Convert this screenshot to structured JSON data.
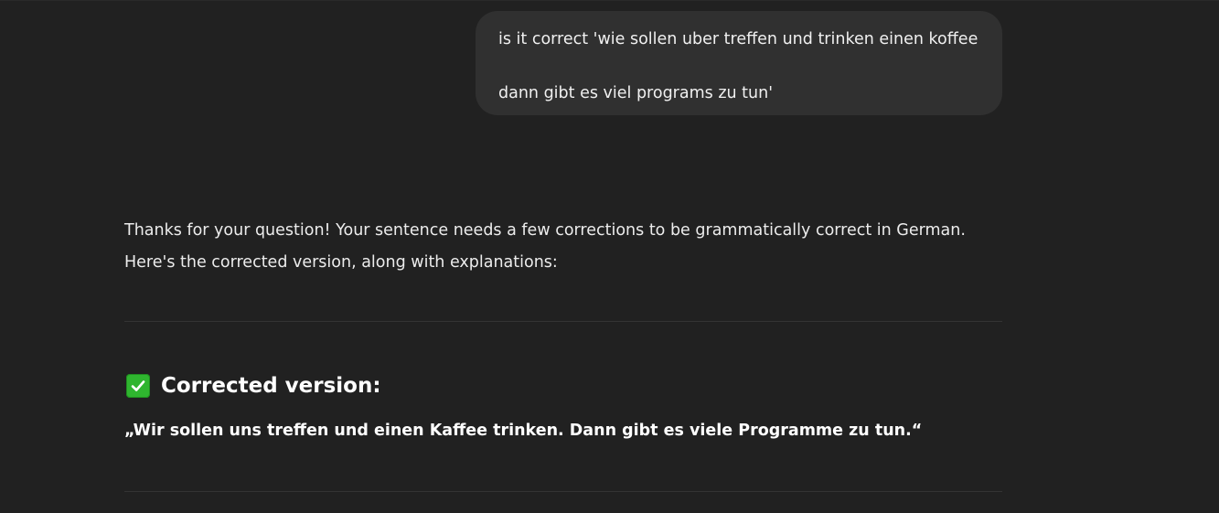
{
  "user_message": {
    "line1": "is it correct 'wie sollen uber treffen und trinken einen koffee",
    "line2": "dann gibt es viel programs zu tun'"
  },
  "assistant": {
    "intro_line1": "Thanks for your question! Your sentence needs a few corrections to be grammatically correct in German.",
    "intro_line2": "Here's the corrected version, along with explanations:",
    "section_icon": "check-mark-button-icon",
    "section_title": "Corrected version:",
    "corrected_sentence": "„Wir sollen uns treffen und einen Kaffee trinken. Dann gibt es viele Programme zu tun.“"
  },
  "colors": {
    "background": "#212121",
    "user_bubble": "#303030",
    "check_green": "#2fb52f",
    "divider": "#343434"
  }
}
